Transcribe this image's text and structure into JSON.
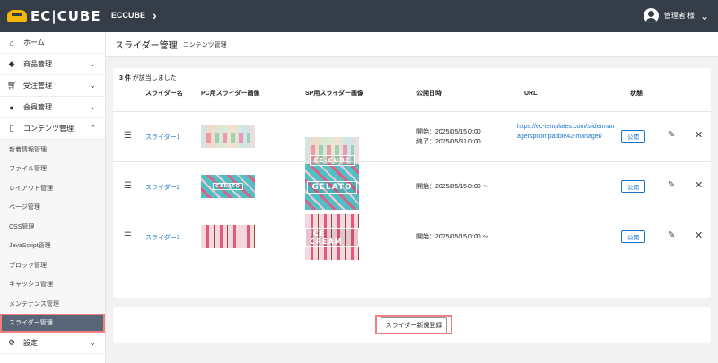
{
  "header": {
    "logo": "EC|CUBE",
    "shop_name": "ECCUBE",
    "user_name": "管理者 様"
  },
  "sidebar": {
    "items": [
      {
        "label": "ホーム",
        "icon": "home-icon"
      },
      {
        "label": "商品管理",
        "icon": "cube-icon"
      },
      {
        "label": "受注管理",
        "icon": "cart-icon"
      },
      {
        "label": "会員管理",
        "icon": "users-icon"
      },
      {
        "label": "コンテンツ管理",
        "icon": "file-icon"
      }
    ],
    "sub_items": [
      "新着情報管理",
      "ファイル管理",
      "レイアウト管理",
      "ページ管理",
      "CSS管理",
      "JavaScript管理",
      "ブロック管理",
      "キャッシュ管理",
      "メンテナンス管理",
      "スライダー管理"
    ],
    "settings_label": "設定"
  },
  "page": {
    "title": "スライダー管理",
    "subtitle": "コンテンツ管理"
  },
  "table": {
    "count_number": "3 件",
    "count_suffix": "が該当しました",
    "headers": {
      "name": "スライダー名",
      "pc_image": "PC用スライダー画像",
      "sp_image": "SP用スライダー画像",
      "publish": "公開日時",
      "url": "URL",
      "status": "状態"
    },
    "rows": [
      {
        "name": "スライダー1",
        "pc_overlay": "",
        "sp_overlay": "EC-CUBE",
        "publish_start": "開始：2025/05/15 0:00",
        "publish_end": "終了：2025/05/31 0:00",
        "url": "https://ec-templates.com/slidermanagerspcompatible42-manager/",
        "status": "公開"
      },
      {
        "name": "スライダー2",
        "pc_overlay": "GELATO",
        "sp_overlay": "GELATO",
        "publish_start": "開始：2025/05/15 0:00 〜",
        "publish_end": "",
        "url": "",
        "status": "公開"
      },
      {
        "name": "スライダー3",
        "pc_overlay": "",
        "sp_overlay": "ICE CREAM",
        "publish_start": "開始：2025/05/15 0:00 〜",
        "publish_end": "",
        "url": "",
        "status": "公開"
      }
    ]
  },
  "actions": {
    "new_button": "スライダー新規登録"
  }
}
